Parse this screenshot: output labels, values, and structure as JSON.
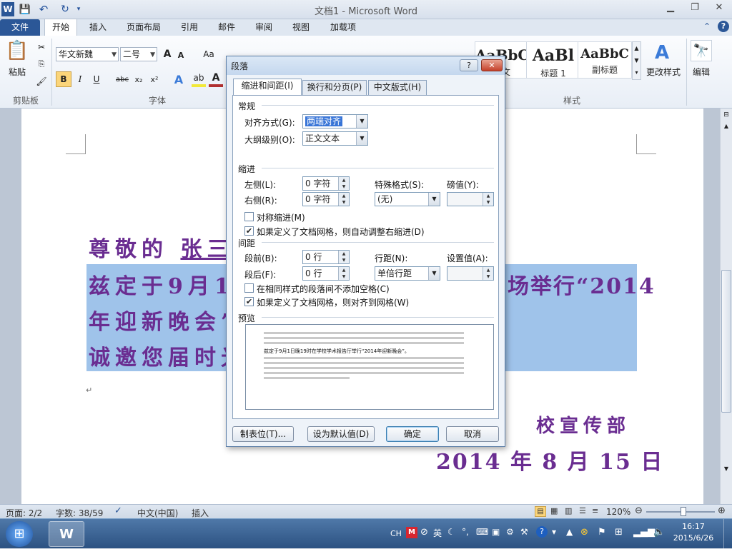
{
  "window": {
    "title": "文档1 - Microsoft Word"
  },
  "qat": {
    "app_icon": "W",
    "save": "💾",
    "undo": "↶",
    "redo": "↻"
  },
  "tabs": [
    "文件",
    "开始",
    "插入",
    "页面布局",
    "引用",
    "邮件",
    "审阅",
    "视图",
    "加载项"
  ],
  "ribbon": {
    "clipboard": {
      "paste": "粘贴",
      "label": "剪贴板"
    },
    "font": {
      "name": "华文新魏",
      "size": "二号",
      "label": "字体",
      "grow": "A",
      "shrink": "A",
      "case": "Aa",
      "bold": "B",
      "italic": "I",
      "underline": "U",
      "strike": "abc",
      "sub": "x₂",
      "sup": "x²"
    },
    "styles": {
      "items": [
        {
          "sample": "AaBbC",
          "caption": "正文"
        },
        {
          "sample": "AaBl",
          "caption": "标题 1"
        },
        {
          "sample": "AaBbC",
          "caption": "副标题"
        }
      ],
      "change": "更改样式",
      "label": "样式"
    },
    "edit": {
      "label": "编辑"
    }
  },
  "document": {
    "salutation": "尊敬的",
    "name": "张三",
    "line2_left": "兹定于9月1",
    "line2_right": "场举行“2014",
    "line3_left": "年迎新晚会”",
    "line4_left": "诚邀您届时光",
    "signature": "校宣传部",
    "date": "2014 年 8 月 15 日",
    "para_mark": "↵"
  },
  "dialog": {
    "title": "段落",
    "help": "?",
    "close": "✕",
    "tabs": [
      "缩进和间距(I)",
      "换行和分页(P)",
      "中文版式(H)"
    ],
    "general": {
      "heading": "常规",
      "alignment_label": "对齐方式(G):",
      "alignment_value": "两端对齐",
      "outline_label": "大纲级别(O):",
      "outline_value": "正文文本"
    },
    "indent": {
      "heading": "缩进",
      "left_label": "左侧(L):",
      "left_value": "0 字符",
      "right_label": "右侧(R):",
      "right_value": "0 字符",
      "special_label": "特殊格式(S):",
      "special_value": "(无)",
      "by_label": "磅值(Y):",
      "mirror": "对称缩进(M)",
      "auto_adjust": "如果定义了文档网格，则自动调整右缩进(D)",
      "mirror_checked": false,
      "auto_adjust_checked": true
    },
    "spacing": {
      "heading": "间距",
      "before_label": "段前(B):",
      "before_value": "0 行",
      "after_label": "段后(F):",
      "after_value": "0 行",
      "line_label": "行距(N):",
      "line_value": "单倍行距",
      "at_label": "设置值(A):",
      "no_space": "在相同样式的段落间不添加空格(C)",
      "snap_grid": "如果定义了文档网格，则对齐到网格(W)",
      "no_space_checked": false,
      "snap_grid_checked": true
    },
    "preview": {
      "heading": "预览",
      "sample": "兹定于9月1日晚19时在学校学术报告厅举行“2014年迎新晚会”。"
    },
    "buttons": {
      "tabs": "制表位(T)...",
      "default": "设为默认值(D)",
      "ok": "确定",
      "cancel": "取消"
    }
  },
  "status": {
    "page": "页面: 2/2",
    "words": "字数: 38/59",
    "lang": "中文(中国)",
    "mode": "插入",
    "zoom": "120%"
  },
  "taskbar": {
    "lang": "CH",
    "time": "16:17",
    "date": "2015/6/26"
  }
}
